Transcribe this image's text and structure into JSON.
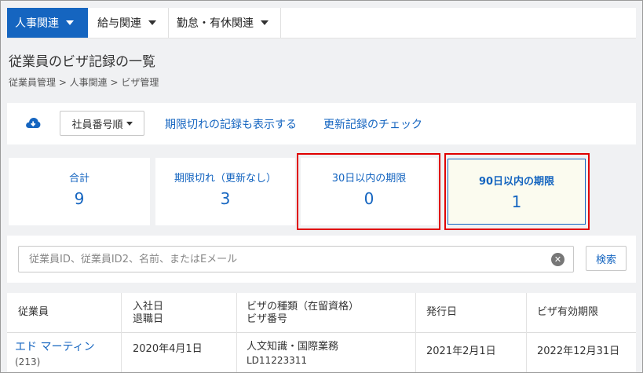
{
  "nav": [
    {
      "label": "人事関連",
      "active": true
    },
    {
      "label": "給与関連",
      "active": false
    },
    {
      "label": "勤怠・有休関連",
      "active": false
    }
  ],
  "page": {
    "title": "従業員のビザ記録の一覧",
    "breadcrumb": "従業員管理 > 人事関連 > ビザ管理"
  },
  "toolbar": {
    "download_icon": "cloud-download-icon",
    "sort_label": "社員番号順",
    "show_expired_link": "期限切れの記録も表示する",
    "renewal_check_link": "更新記録のチェック"
  },
  "stats": [
    {
      "label": "合計",
      "value": "9"
    },
    {
      "label": "期限切れ（更新なし）",
      "value": "3"
    },
    {
      "label": "30日以内の期限",
      "value": "0"
    },
    {
      "label": "90日以内の期限",
      "value": "1"
    }
  ],
  "search": {
    "placeholder": "従業員ID、従業員ID2、名前、またはEメール",
    "value": "",
    "button_label": "検索"
  },
  "table": {
    "headers": {
      "employee": "従業員",
      "hire_date": "入社日",
      "leave_date": "退職日",
      "visa_type": "ビザの種類（在留資格）",
      "visa_number": "ビザ番号",
      "issue_date": "発行日",
      "expiry_date": "ビザ有効期限"
    },
    "rows": [
      {
        "name": "エド マーティン",
        "id": "(213)",
        "hire_date": "2020年4月1日",
        "visa_type": "人文知識・国際業務",
        "visa_number": "LD11223311",
        "issue_date": "2021年2月1日",
        "expiry_date": "2022年12月31日"
      }
    ]
  },
  "colors": {
    "accent": "#1565c0",
    "highlight_border": "#e00000",
    "selected_card_bg": "#fbfbef"
  }
}
